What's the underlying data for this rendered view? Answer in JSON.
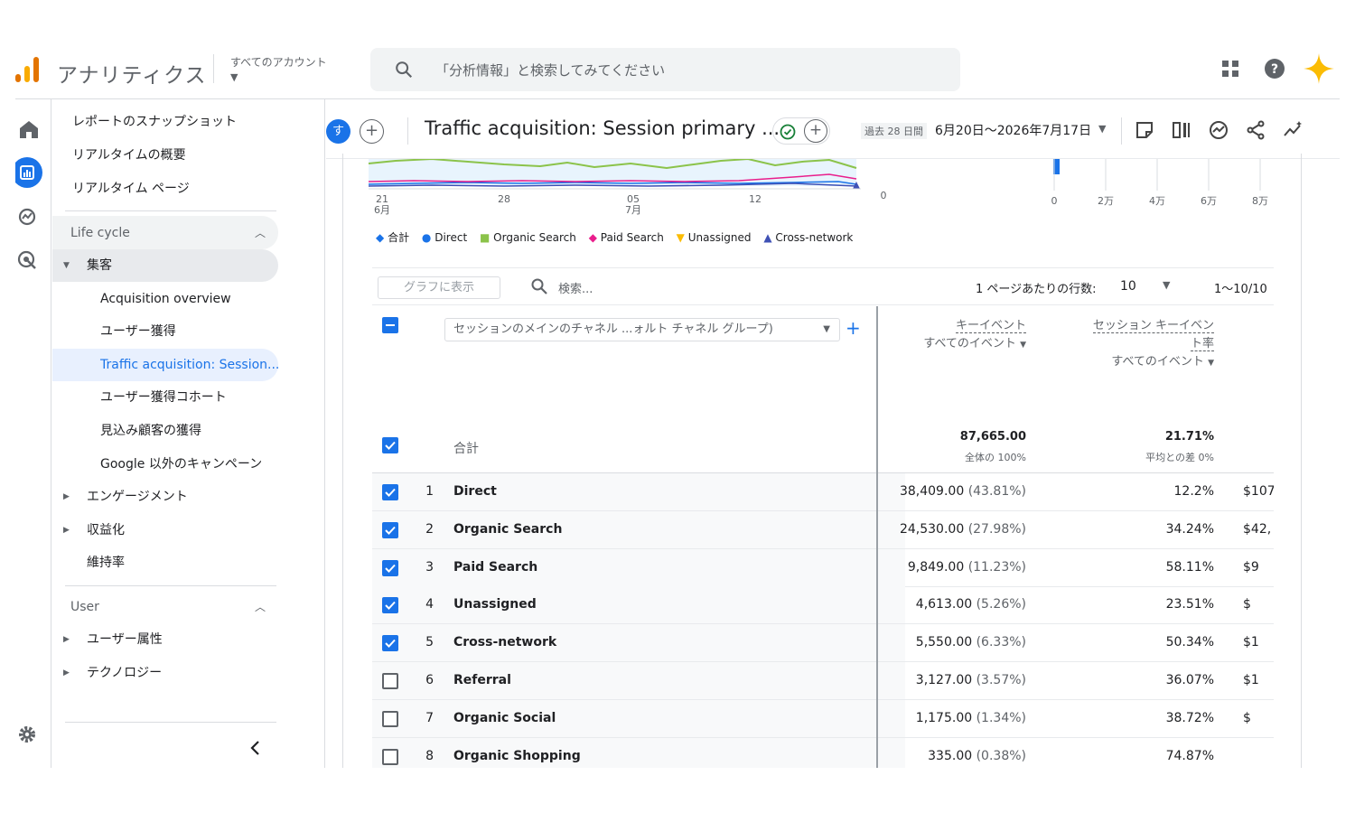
{
  "app": {
    "title": "アナリティクス",
    "account": "すべてのアカウント",
    "search_placeholder": "「分析情報」と検索してみてください"
  },
  "icons": {
    "logo": "analytics-logo",
    "search": "search-icon",
    "apps": "apps-grid-icon",
    "help": "help-icon",
    "spark": "gemini-spark-icon"
  },
  "colors": {
    "accent": "#1a73e8",
    "total": "#1a73e8",
    "direct": "#1a73e8",
    "organic_search": "#8bc34a",
    "paid_search": "#e91e8c",
    "unassigned": "#fbbc04",
    "cross_network": "#3f51b5"
  },
  "sidebar": {
    "top_items": [
      "レポートのスナップショット",
      "リアルタイムの概要",
      "リアルタイム ページ"
    ],
    "lifecycle": "Life cycle",
    "acquisition": "集客",
    "acq_items": [
      "Acquisition overview",
      "ユーザー獲得",
      "Traffic acquisition: Session...",
      "ユーザー獲得コホート",
      "見込み顧客の獲得",
      "Google 以外のキャンペーン"
    ],
    "engagement": "エンゲージメント",
    "monetization": "収益化",
    "retention": "維持率",
    "user": "User",
    "user_attributes": "ユーザー属性",
    "technology": "テクノロジー"
  },
  "header": {
    "avatar": "す",
    "title": "Traffic acquisition: Session primary ...",
    "date_label": "過去 28 日間",
    "date_range": "6月20日〜2026年7月17日"
  },
  "chart_data": [
    {
      "type": "line",
      "x_ticks": [
        {
          "day": "21",
          "month": "6月"
        },
        {
          "day": "28",
          "month": ""
        },
        {
          "day": "05",
          "month": "7月"
        },
        {
          "day": "12",
          "month": ""
        }
      ],
      "y_tick": "0",
      "legend": [
        "合計",
        "Direct",
        "Organic Search",
        "Paid Search",
        "Unassigned",
        "Cross-network"
      ]
    },
    {
      "type": "bar",
      "x_ticks": [
        "0",
        "2万",
        "4万",
        "6万",
        "8万"
      ]
    }
  ],
  "table": {
    "graph_button": "グラフに表示",
    "search_placeholder": "検索...",
    "rows_per_page_label": "1 ページあたりの行数:",
    "rows_per_page": "10",
    "pager": "1〜10/10",
    "dimension": "セッションのメインのチャネル ...ォルト チャネル グループ)",
    "col1_title": "キーイベント",
    "col1_sub": "すべてのイベント",
    "col2_title_a": "セッション キーイベン",
    "col2_title_b": "ト率",
    "col2_sub": "すべてのイベント",
    "total_label": "合計",
    "total_col1": "87,665.00",
    "total_col1_sub": "全体の 100%",
    "total_col2": "21.71%",
    "total_col2_sub": "平均との差 0%",
    "rows": [
      {
        "idx": "1",
        "name": "Direct",
        "val": "38,409.00",
        "pct": "(43.81%)",
        "rate": "12.2%",
        "rev": "$107,",
        "checked": true
      },
      {
        "idx": "2",
        "name": "Organic Search",
        "val": "24,530.00",
        "pct": "(27.98%)",
        "rate": "34.24%",
        "rev": "$42,",
        "checked": true
      },
      {
        "idx": "3",
        "name": "Paid Search",
        "val": "9,849.00",
        "pct": "(11.23%)",
        "rate": "58.11%",
        "rev": "$9",
        "checked": true
      },
      {
        "idx": "4",
        "name": "Unassigned",
        "val": "4,613.00",
        "pct": "(5.26%)",
        "rate": "23.51%",
        "rev": "$",
        "checked": true
      },
      {
        "idx": "5",
        "name": "Cross-network",
        "val": "5,550.00",
        "pct": "(6.33%)",
        "rate": "50.34%",
        "rev": "$1",
        "checked": true
      },
      {
        "idx": "6",
        "name": "Referral",
        "val": "3,127.00",
        "pct": "(3.57%)",
        "rate": "36.07%",
        "rev": "$1",
        "checked": false
      },
      {
        "idx": "7",
        "name": "Organic Social",
        "val": "1,175.00",
        "pct": "(1.34%)",
        "rate": "38.72%",
        "rev": "$",
        "checked": false
      },
      {
        "idx": "8",
        "name": "Organic Shopping",
        "val": "335.00",
        "pct": "(0.38%)",
        "rate": "74.87%",
        "rev": "",
        "checked": false
      }
    ]
  }
}
